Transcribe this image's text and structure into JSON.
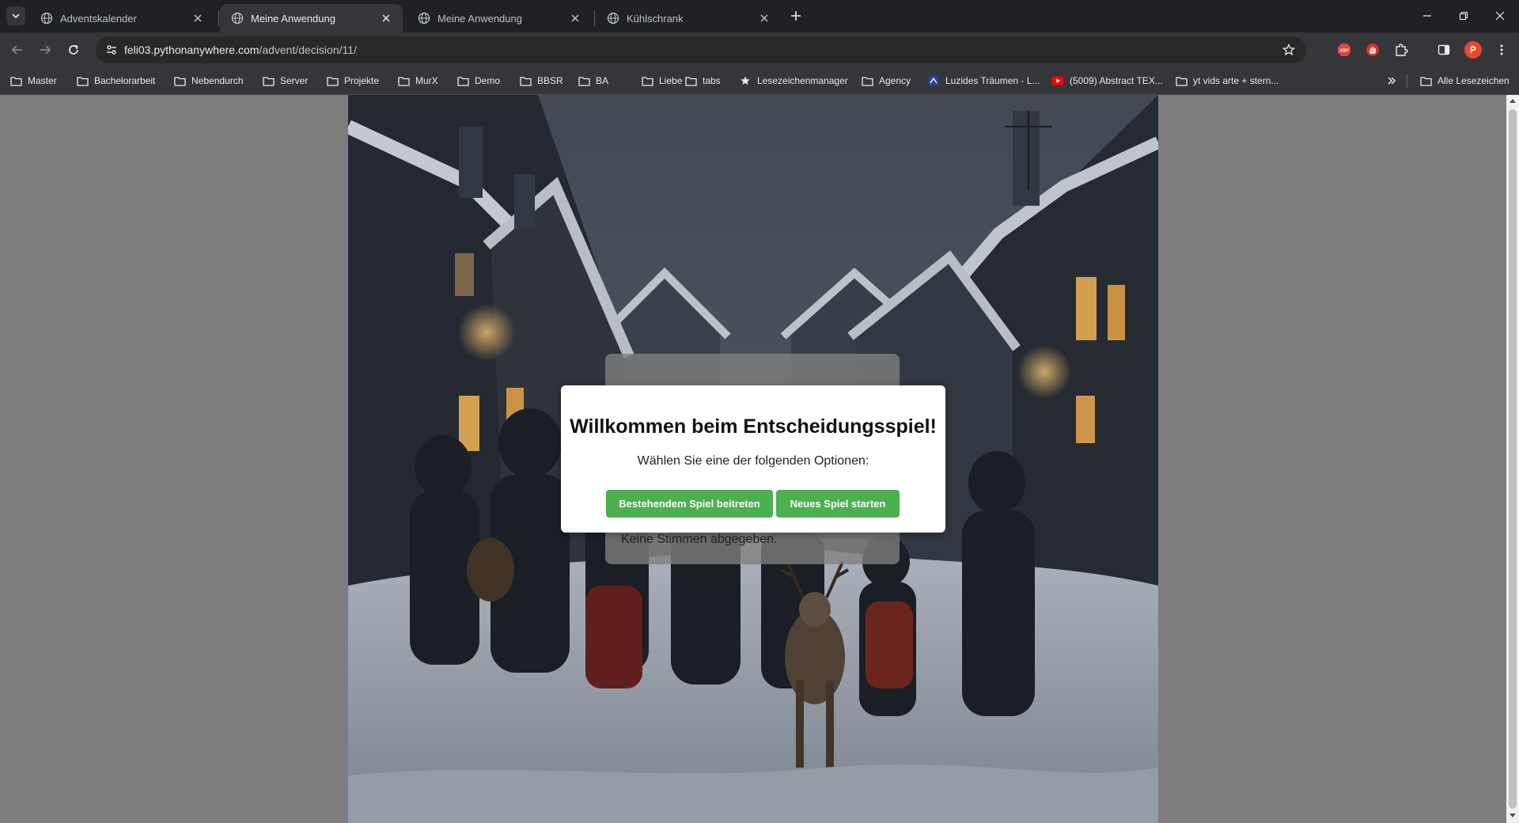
{
  "browser": {
    "tabs": [
      {
        "label": "Adventskalender",
        "active": false
      },
      {
        "label": "Meine Anwendung",
        "active": true
      },
      {
        "label": "Meine Anwendung",
        "active": false
      },
      {
        "label": "Kühlschrank",
        "active": false
      }
    ],
    "url": {
      "host": "feli03.pythonanywhere.com",
      "path": "/advent/decision/11/"
    },
    "profile_initial": "P",
    "extensions": {
      "abp_label": "ABP"
    },
    "bookmarks": [
      {
        "label": "Master",
        "icon": "folder-icon"
      },
      {
        "label": "Bachelorarbeit",
        "icon": "folder-icon"
      },
      {
        "label": "Nebendurch",
        "icon": "folder-icon"
      },
      {
        "label": "Server",
        "icon": "folder-icon"
      },
      {
        "label": "Projekte",
        "icon": "folder-icon"
      },
      {
        "label": "MurX",
        "icon": "folder-icon"
      },
      {
        "label": "Demo",
        "icon": "folder-icon"
      },
      {
        "label": "BBSR",
        "icon": "folder-icon"
      },
      {
        "label": "BA",
        "icon": "folder-icon"
      },
      {
        "label": "Liebe",
        "icon": "folder-icon"
      },
      {
        "label": "tabs",
        "icon": "folder-icon"
      },
      {
        "label": "Lesezeichenmanager",
        "icon": "star-icon"
      },
      {
        "label": "Agency",
        "icon": "folder-icon"
      },
      {
        "label": "Luzides Träumen - L...",
        "icon": "site-icon"
      },
      {
        "label": "(5009) Abstract TEX...",
        "icon": "youtube-icon"
      },
      {
        "label": "yt vids arte + stern...",
        "icon": "folder-icon"
      }
    ],
    "all_bookmarks": "Alle Lesezeichen"
  },
  "page": {
    "status_text": "Keine Stimmen abgegeben.",
    "modal": {
      "title": "Willkommen beim Entscheidungsspiel!",
      "subtitle": "Wählen Sie eine der folgenden Optionen:",
      "join_button": "Bestehendem Spiel beitreten",
      "new_button": "Neues Spiel starten"
    }
  },
  "colors": {
    "button_green": "#4caf50",
    "tab_bar": "#202124",
    "toolbar": "#35363a",
    "profile": "#e8492b"
  }
}
